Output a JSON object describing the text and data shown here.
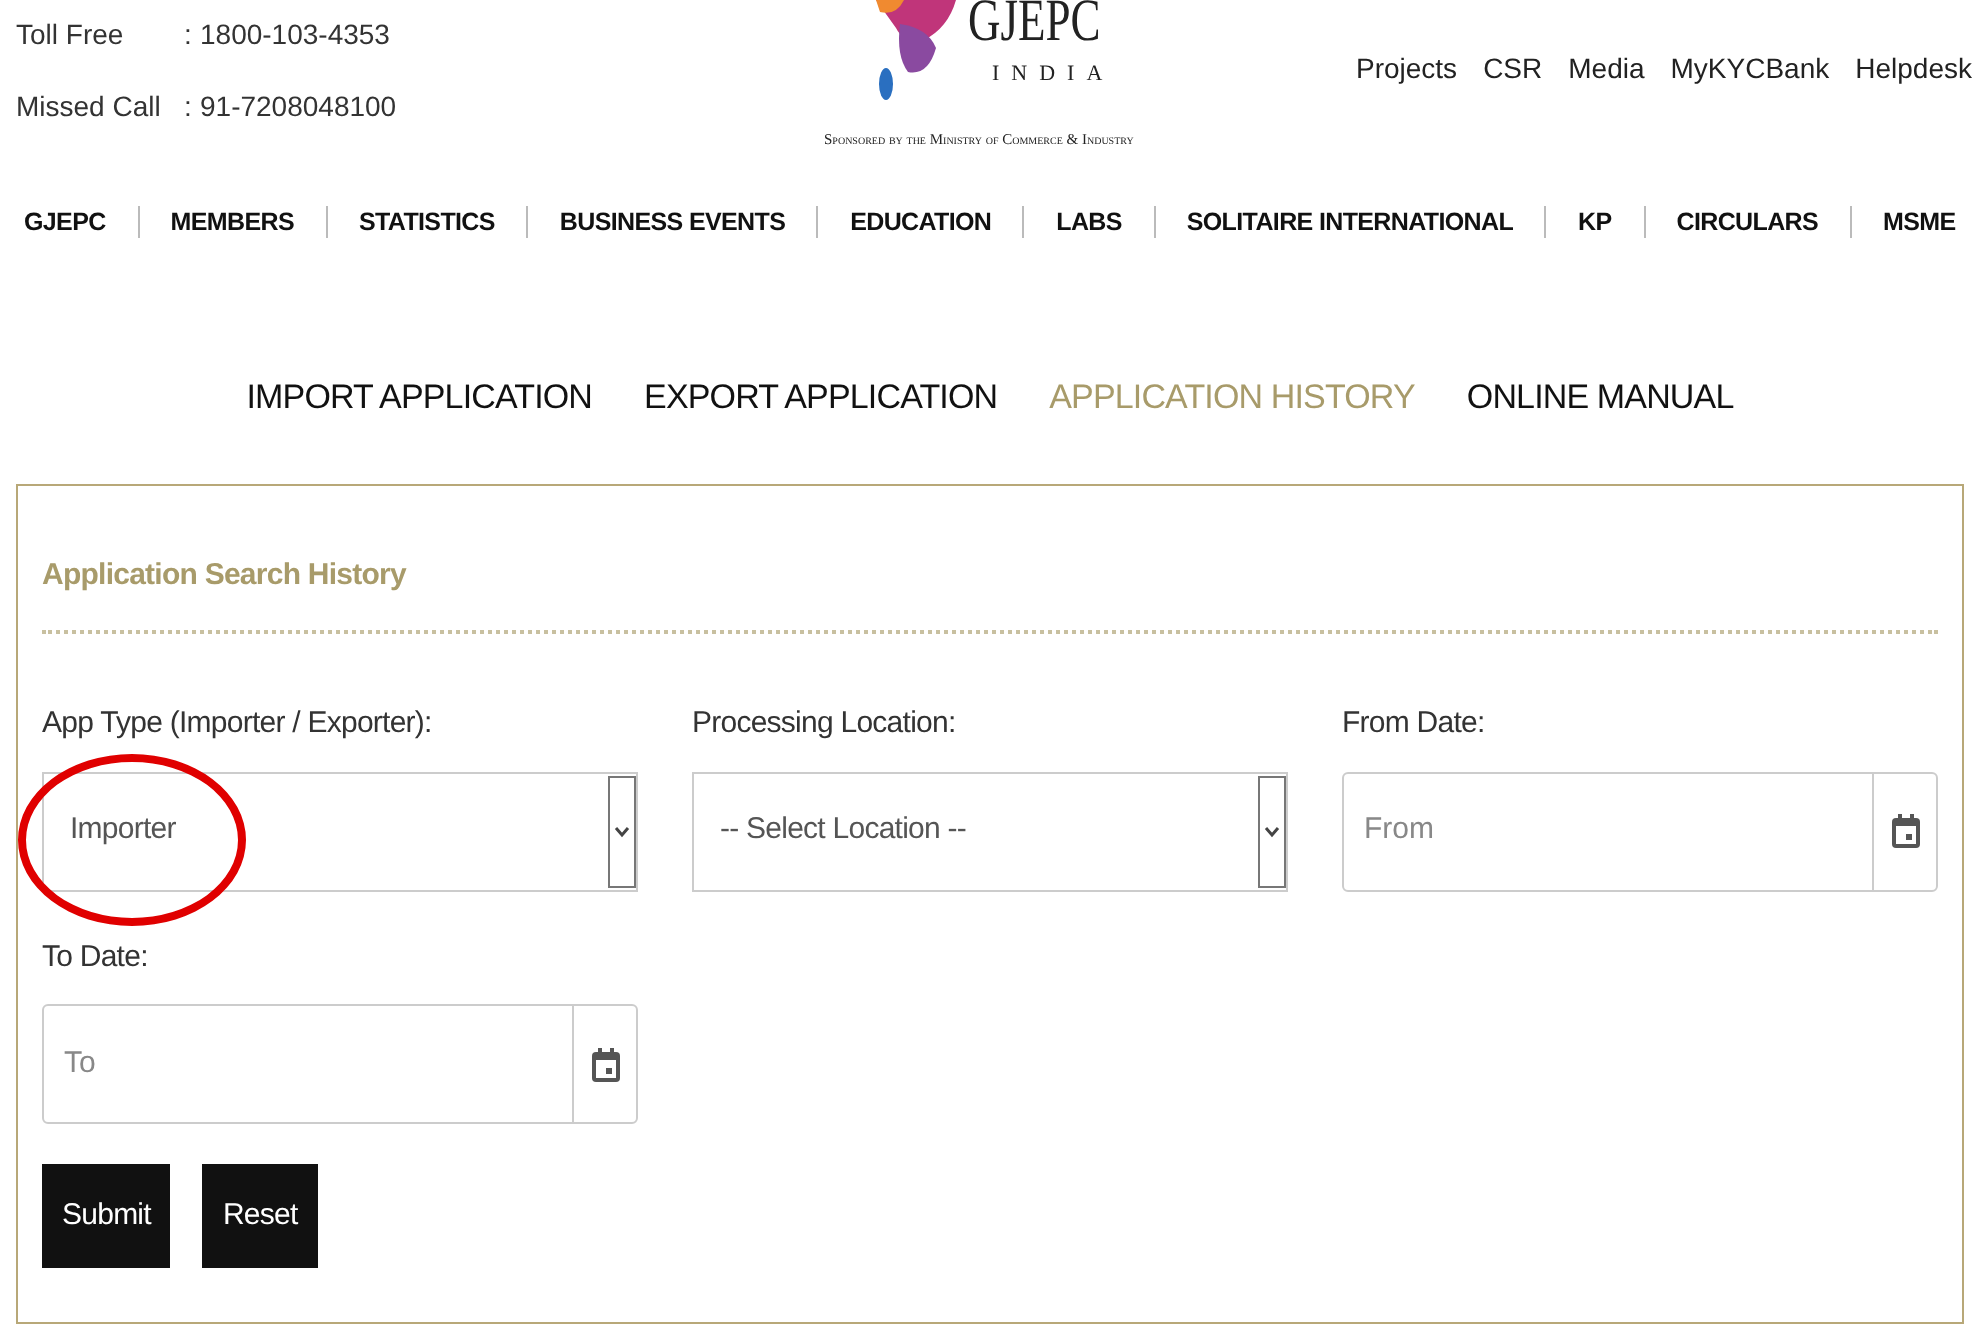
{
  "contact": [
    {
      "label": "Toll Free",
      "separator": ":",
      "value": "1800-103-4353"
    },
    {
      "label": "Missed Call",
      "separator": ":",
      "value": "91-7208048100"
    }
  ],
  "logo": {
    "name": "GJEPC",
    "country": "INDIA",
    "tagline": "Sponsored by the Ministry of Commerce & Industry"
  },
  "top_links": [
    "Projects",
    "CSR",
    "Media",
    "MyKYCBank",
    "Helpdesk"
  ],
  "main_nav": [
    "GJEPC",
    "MEMBERS",
    "STATISTICS",
    "BUSINESS EVENTS",
    "EDUCATION",
    "LABS",
    "SOLITAIRE INTERNATIONAL",
    "KP",
    "CIRCULARS",
    "MSME"
  ],
  "tabs": [
    {
      "label": "IMPORT APPLICATION",
      "selected": false
    },
    {
      "label": "EXPORT APPLICATION",
      "selected": false
    },
    {
      "label": "APPLICATION HISTORY",
      "selected": true
    },
    {
      "label": "ONLINE MANUAL",
      "selected": false
    }
  ],
  "panel": {
    "title": "Application Search History",
    "fields": [
      {
        "kind": "select",
        "label": "App Type (Importer / Exporter):",
        "value": "Importer",
        "highlighted": true
      },
      {
        "kind": "select",
        "label": "Processing Location:",
        "value": "-- Select Location --",
        "highlighted": false
      },
      {
        "kind": "date",
        "label": "From Date:",
        "placeholder": "From",
        "highlighted": false
      },
      {
        "kind": "date",
        "label": "To Date:",
        "placeholder": "To",
        "highlighted": false
      }
    ],
    "buttons": [
      "Submit",
      "Reset"
    ]
  }
}
